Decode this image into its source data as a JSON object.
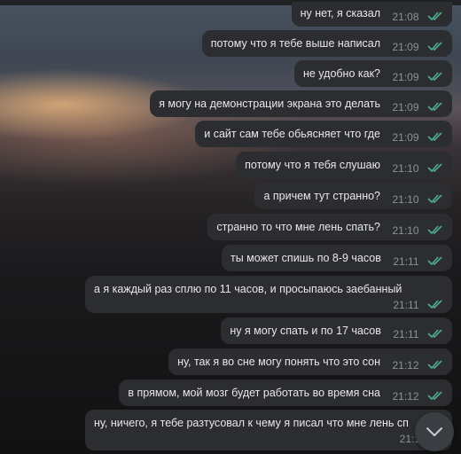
{
  "messages": [
    {
      "text": "ну нет, я сказал",
      "time": "21:08",
      "read": true
    },
    {
      "text": "потому что я тебе выше написал",
      "time": "21:09",
      "read": true
    },
    {
      "text": "не удобно как?",
      "time": "21:09",
      "read": true
    },
    {
      "text": "я могу на демонстрации экрана это делать",
      "time": "21:09",
      "read": true
    },
    {
      "text": "и сайт сам тебе обьясняет что где",
      "time": "21:09",
      "read": true
    },
    {
      "text": "потому что я тебя слушаю",
      "time": "21:10",
      "read": true
    },
    {
      "text": "а причем тут странно?",
      "time": "21:10",
      "read": true
    },
    {
      "text": "странно то что мне лень спать?",
      "time": "21:10",
      "read": true
    },
    {
      "text": "ты может спишь по  8-9 часов",
      "time": "21:11",
      "read": true
    },
    {
      "text": "а я каждый раз сплю по 11 часов, и просыпаюсь заебанный",
      "time": "21:11",
      "read": true
    },
    {
      "text": "ну я могу спать и по 17 часов",
      "time": "21:11",
      "read": true
    },
    {
      "text": "ну, так я во сне могу понять что это сон",
      "time": "21:12",
      "read": true
    },
    {
      "text": "в прямом, мой мозг будет работать во время сна",
      "time": "21:12",
      "read": true
    },
    {
      "text": "ну, ничего, я тебе разтусовал к чему я писал что мне лень сп",
      "time": "21:1",
      "read": true
    }
  ],
  "icons": {
    "read_receipt": "double-check-icon",
    "scroll_down": "chevron-down-icon"
  },
  "colors": {
    "bubble": "#2b2d30",
    "check": "#4fae8e",
    "time": "#8d9196"
  }
}
